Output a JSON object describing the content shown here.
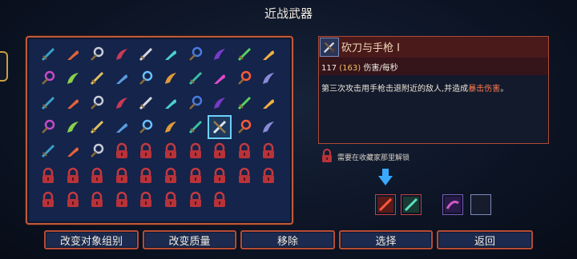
{
  "header": {
    "title": "近战武器"
  },
  "detail": {
    "name": "砍刀与手枪 I",
    "dps_base": "117",
    "dps_alt": "(163)",
    "dps_unit": "伤害/每秒",
    "description_prefix": "第三次攻击用手枪击退附近的敌人,并造成",
    "description_highlight": "暴击伤害",
    "description_suffix": "。"
  },
  "unlock": {
    "text": "需要在收藏家那里解锁"
  },
  "buttons": {
    "change_group": "改变对象组别",
    "change_quality": "改变质量",
    "remove": "移除",
    "select": "选择",
    "back": "返回"
  },
  "colors": {
    "accent_red": "#b84c34",
    "crit_orange": "#ff7a50",
    "alt_gold": "#f0c060",
    "selection_cyan": "#6fd0ff"
  },
  "grid": {
    "unlocked_weapons": [
      "weapon-1",
      "weapon-2",
      "weapon-3",
      "weapon-4",
      "weapon-5",
      "weapon-6",
      "weapon-7",
      "weapon-8",
      "weapon-9",
      "weapon-10",
      "weapon-11",
      "weapon-12",
      "weapon-13",
      "weapon-14",
      "weapon-15",
      "weapon-16",
      "weapon-17",
      "weapon-18",
      "weapon-19",
      "weapon-20",
      "weapon-21",
      "weapon-22",
      "weapon-23",
      "weapon-24",
      "weapon-25",
      "weapon-26",
      "weapon-27",
      "weapon-28",
      "weapon-29",
      "weapon-30",
      "weapon-31",
      "weapon-32",
      "weapon-33",
      "weapon-34",
      "weapon-35",
      "weapon-36",
      "weapon-37",
      "weapon-38",
      "weapon-39",
      "weapon-40",
      "weapon-41",
      "weapon-42",
      "weapon-43"
    ],
    "locked_count": 25,
    "selected_index": 37
  },
  "slots": [
    "weapon-slot-1",
    "weapon-slot-2",
    "weapon-slot-3",
    "empty-slot"
  ]
}
